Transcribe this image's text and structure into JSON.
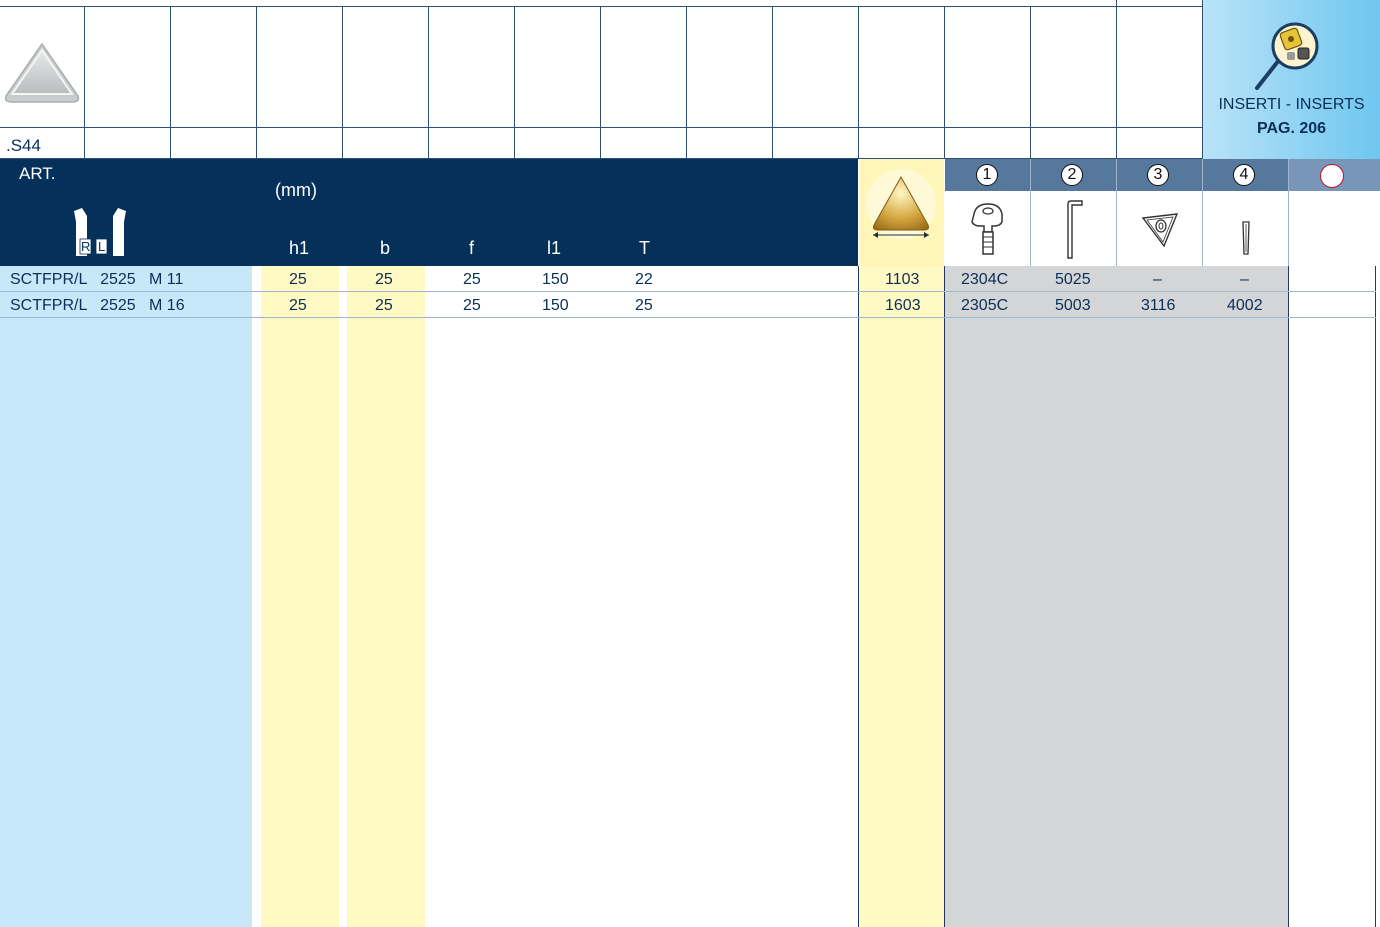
{
  "top_row": {
    "code_label": ".S44"
  },
  "inserts_box": {
    "line1": "INSERTI - INSERTS",
    "line2": "PAG. 206"
  },
  "header": {
    "art_label": "ART.",
    "unit_label": "(mm)",
    "hand_labels": [
      "R",
      "L"
    ],
    "columns": [
      "h1",
      "b",
      "f",
      "l1",
      "T"
    ],
    "spare_numbers": [
      "1",
      "2",
      "3",
      "4"
    ]
  },
  "rows": [
    {
      "art": "SCTFPR/L   2525   M 11",
      "h1": "25",
      "b": "25",
      "f": "25",
      "l1": "150",
      "T": "22",
      "insert": "1103",
      "p1": "2304C",
      "p2": "5025",
      "p3": "–",
      "p4": "–"
    },
    {
      "art": "SCTFPR/L   2525   M 16",
      "h1": "25",
      "b": "25",
      "f": "25",
      "l1": "150",
      "T": "25",
      "insert": "1603",
      "p1": "2305C",
      "p2": "5003",
      "p3": "3116",
      "p4": "4002"
    }
  ],
  "colors": {
    "navy": "#05305a",
    "light_blue": "#c7e8f8",
    "light_yellow": "#fff9c4",
    "gray": "#d3d5d7",
    "slate": "#57789d"
  }
}
